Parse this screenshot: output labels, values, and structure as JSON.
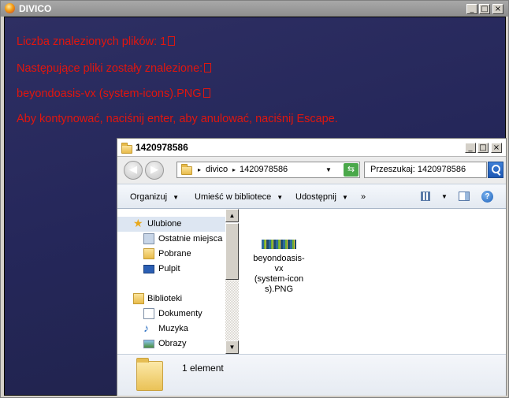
{
  "outer": {
    "title": "DIVICO",
    "messages": [
      "Liczba znalezionych plików: 1",
      "Następujące pliki zostały znalezione:",
      "beyondoasis-vx (system-icons).PNG",
      "Aby kontynować, naciśnij enter, aby anulować, naciśnij Escape."
    ],
    "message_color": "#e0160e",
    "background": "#25275a"
  },
  "explorer": {
    "title": "1420978586",
    "address": {
      "root": "divico",
      "current": "1420978586"
    },
    "search_placeholder": "Przeszukaj: 1420978586",
    "toolbar": {
      "organize": "Organizuj",
      "include": "Umieść w bibliotece",
      "share": "Udostępnij",
      "more": "»"
    },
    "nav": {
      "favorites": "Ulubione",
      "recent": "Ostatnie miejsca",
      "downloads": "Pobrane",
      "desktop": "Pulpit",
      "libraries": "Biblioteki",
      "documents": "Dokumenty",
      "music": "Muzyka",
      "pictures": "Obrazy"
    },
    "file": {
      "name_lines": [
        "beyondoasis-",
        "vx",
        "(system-icon",
        "s).PNG"
      ]
    },
    "status_text": "1 element"
  }
}
